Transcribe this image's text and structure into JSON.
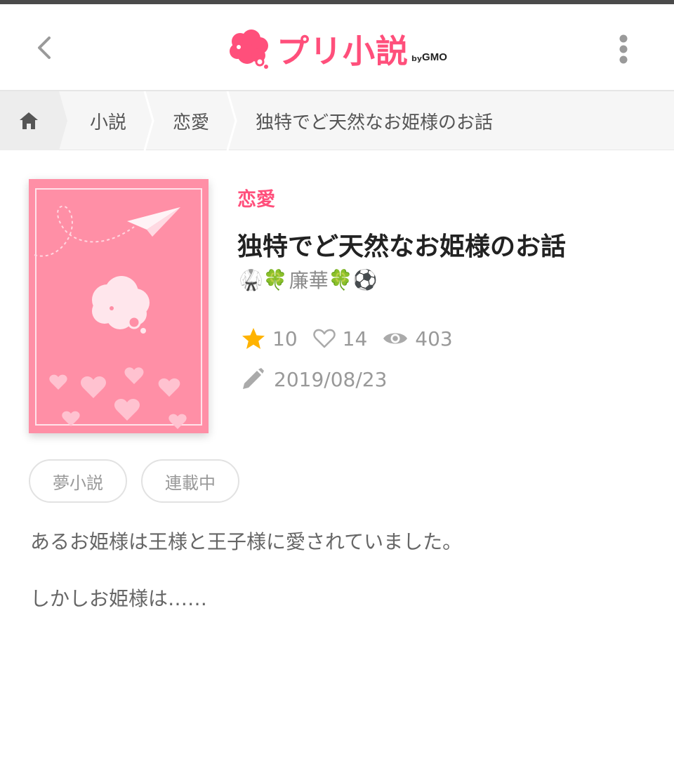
{
  "header": {
    "logo_text": "プリ小説",
    "logo_by": "by",
    "logo_brand": "GMO",
    "back_icon": "chevron-left-icon",
    "menu_icon": "more-vertical-icon",
    "brand_color": "#ff4f7b"
  },
  "breadcrumb": {
    "home_icon": "home-icon",
    "items": [
      "小説",
      "恋愛",
      "独特でど天然なお姫様のお話"
    ]
  },
  "novel": {
    "genre": "恋愛",
    "title": "独特でど天然なお姫様のお話",
    "author": {
      "name": "廉華",
      "prefix_emojis": "🥋🍀",
      "suffix_emojis": "🍀⚽"
    },
    "stats": {
      "stars": "10",
      "likes": "14",
      "views": "403"
    },
    "updated": "2019/08/23",
    "tags": [
      "夢小説",
      "連載中"
    ],
    "description": [
      "あるお姫様は王様と王子様に愛されていました。",
      "しかしお姫様は……"
    ],
    "cover_color": "#ff8fa6"
  }
}
